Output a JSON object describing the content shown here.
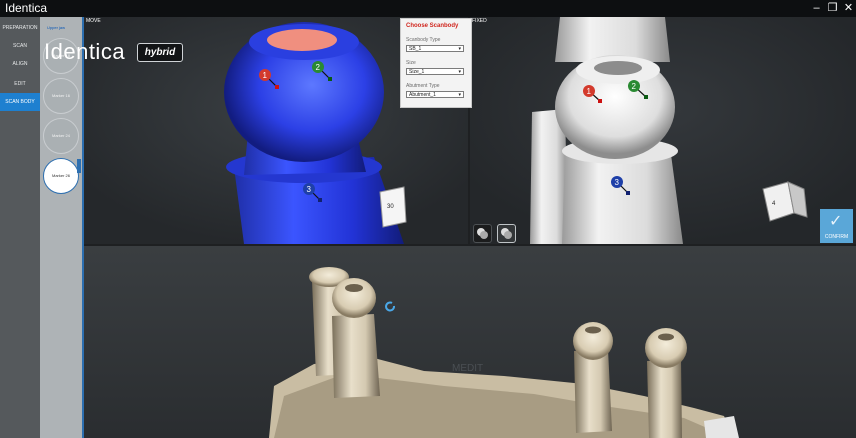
{
  "window": {
    "title": "Identica"
  },
  "sidebar": {
    "items": [
      {
        "label": "PREPARATION"
      },
      {
        "label": "SCAN"
      },
      {
        "label": "ALIGN"
      },
      {
        "label": "EDIT"
      },
      {
        "label": "SCAN BODY"
      }
    ]
  },
  "markers": {
    "jaw_label": "Upper jaw",
    "items": [
      {
        "label": "Marker 18"
      },
      {
        "label": "Marker 16"
      },
      {
        "label": "Marker 24"
      },
      {
        "label": "Marker 26"
      }
    ]
  },
  "logo": {
    "name": "Identica",
    "badge": "hybrid"
  },
  "move_view": {
    "label": "MOVE",
    "marker_numbers": [
      "1",
      "2",
      "3"
    ],
    "cube_face": "30"
  },
  "fixed_view": {
    "label": "FIXED",
    "marker_numbers": [
      "1",
      "2",
      "3"
    ],
    "cube_face": "4"
  },
  "bottom_view": {
    "watermark": "MEDIT"
  },
  "choose_scanbody": {
    "title": "Choose Scanbody",
    "fields": [
      {
        "label": "Scanbody Type",
        "value": "SB_1"
      },
      {
        "label": "Size",
        "value": "Size_1"
      },
      {
        "label": "Abutment Type",
        "value": "Abutment_1"
      }
    ]
  },
  "confirm": {
    "label": "CONFIRM"
  },
  "colors": {
    "accent": "#1e80d0",
    "marker_1": "#d33a2c",
    "marker_2": "#2a8a32",
    "marker_3": "#1e3fa8"
  }
}
